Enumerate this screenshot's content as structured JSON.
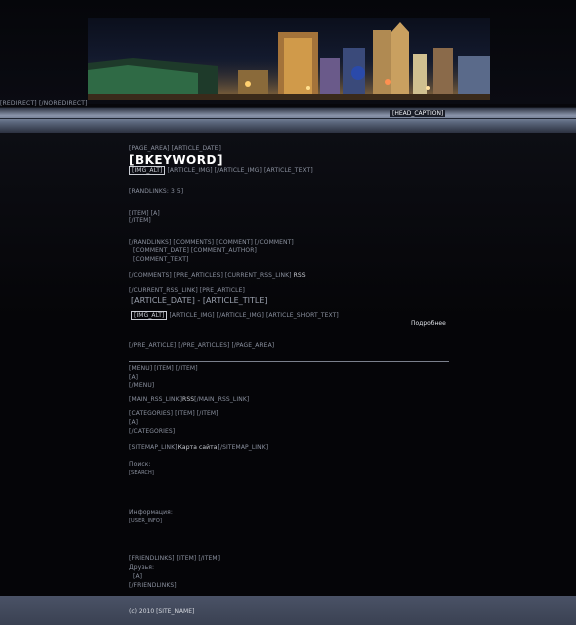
{
  "header": {
    "redirect": "[REDIRECT] [/NOREDIRECT]",
    "head_caption": "[HEAD_CAPTION]"
  },
  "article": {
    "page_area_open": "[PAGE_AREA] [ARTICLE_DATE]",
    "keyword": "[BKEYWORD]",
    "img_alt": "[IMG_ALT]",
    "line1_rest": "[ARTICLE_IMG] [/ARTICLE_IMG] [ARTICLE_TEXT]",
    "randlinks": "[RANDLINKS: 3 5]",
    "item_open": "[ITEM] [A]",
    "item_close": "[/ITEM]",
    "randlinks_close": "[/RANDLINKS] [COMMENTS] [COMMENT] [/COMMENT]",
    "comment_date": "[COMMENT_DATE] [COMMENT_AUTHOR]",
    "comment_text": "[COMMENT_TEXT]",
    "comments_close_pre": "[/COMMENTS] [PRE_ARTICLES] [CURRENT_RSS_LINK]",
    "comments_close_rss": "RSS",
    "current_rss": "[/CURRENT_RSS_LINK] [PRE_ARTICLE]",
    "article_date_title": "[ARTICLE_DATE] - [ARTICLE_TITLE]",
    "img_alt2": "[IMG_ALT]",
    "line2_rest": "[ARTICLE_IMG] [/ARTICLE_IMG] [ARTICLE_SHORT_TEXT]",
    "more": "Подробнее",
    "pre_article_close": "[/PRE_ARTICLE] [/PRE_ARTICLES] [/PAGE_AREA]"
  },
  "sidebar": {
    "menu": "[MENU] [ITEM] [/ITEM]",
    "menu_a": "[A]",
    "menu_close": "[/MENU]",
    "main_rss_open": "[MAIN_RSS_LINK]",
    "main_rss_label": "RSS",
    "main_rss_close": "[/MAIN_RSS_LINK]",
    "categories": "[CATEGORIES] [ITEM] [/ITEM]",
    "cat_a": "[A]",
    "cat_close": "[/CATEGORIES]",
    "sitemap_open": "[SITEMAP_LINK]",
    "sitemap_label": "Карта сайта",
    "sitemap_close": "[/SITEMAP_LINK]",
    "search_label": "Поиск:",
    "search_value": "[SEARCH]",
    "info_label": "Информация:",
    "info_value": "[USER_INFO]",
    "friendlinks": "[FRIENDLINKS] [ITEM] [/ITEM]",
    "friends_label": "Друзья:",
    "friends_a": "[A]",
    "friends_close": "[/FRIENDLINKS]"
  },
  "footer": {
    "copyright": "(c) 2010 [SITE_NAME]"
  },
  "colors": {
    "background": "#07070b",
    "bar": "#8a95ab",
    "footer": "#4a5266",
    "text": "#8c92a0"
  }
}
